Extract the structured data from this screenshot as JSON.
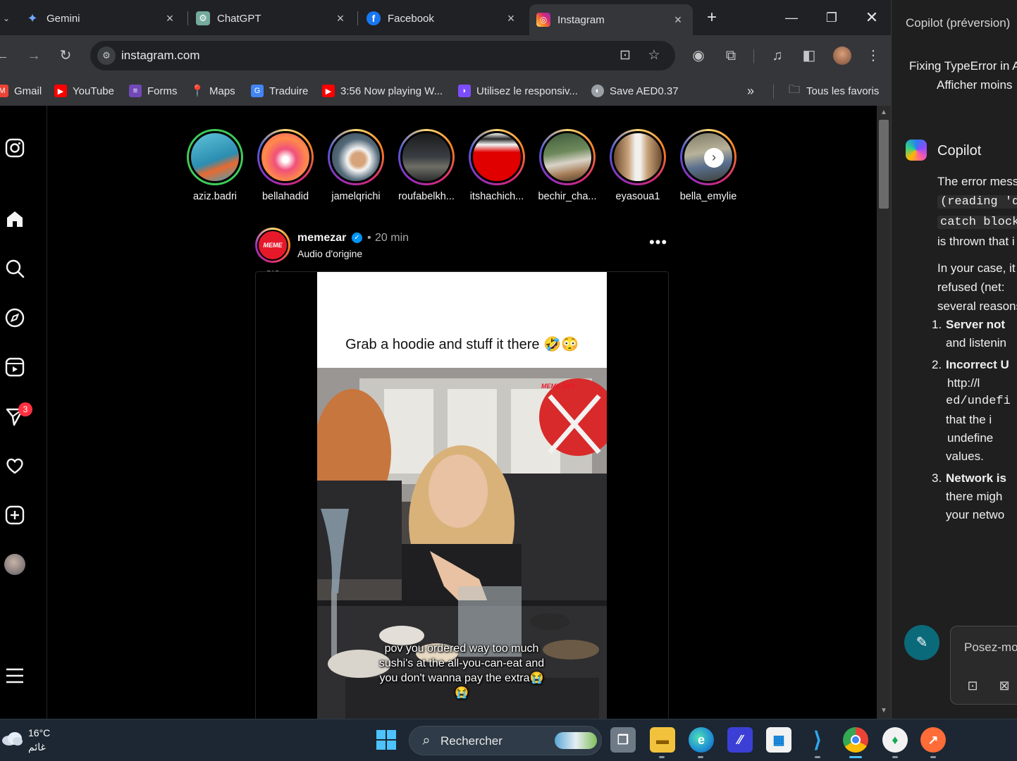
{
  "browser": {
    "tabs": [
      {
        "label": "Gemini",
        "icon": "gemini-icon",
        "active": false
      },
      {
        "label": "ChatGPT",
        "icon": "chatgpt-icon",
        "active": false
      },
      {
        "label": "Facebook",
        "icon": "facebook-icon",
        "active": false
      },
      {
        "label": "Instagram",
        "icon": "instagram-icon",
        "active": true
      }
    ],
    "url": "instagram.com",
    "bookmarks": [
      {
        "label": "Gmail",
        "icon": "gmail-icon",
        "color": "#ea4335"
      },
      {
        "label": "YouTube",
        "icon": "youtube-icon",
        "color": "#ff0000"
      },
      {
        "label": "Forms",
        "icon": "forms-icon",
        "color": "#7248b9"
      },
      {
        "label": "Maps",
        "icon": "maps-icon",
        "color": "#34a853"
      },
      {
        "label": "Traduire",
        "icon": "translate-icon",
        "color": "#4285f4"
      },
      {
        "label": "3:56 Now playing W...",
        "icon": "youtube-icon",
        "color": "#ff0000"
      },
      {
        "label": "Utilisez le responsiv...",
        "icon": "bookmark-app-icon",
        "color": "#7c4dff"
      },
      {
        "label": "Save AED0.37",
        "icon": "globe-icon",
        "color": "#9aa0a6"
      }
    ],
    "all_bookmarks": "Tous les favoris"
  },
  "instagram": {
    "stories": [
      {
        "username": "aziz.badri",
        "seen": true
      },
      {
        "username": "bellahadid",
        "seen": false
      },
      {
        "username": "jamelqrichi",
        "seen": false
      },
      {
        "username": "roufabelkh...",
        "seen": false
      },
      {
        "username": "itshachich...",
        "seen": false
      },
      {
        "username": "bechir_cha...",
        "seen": false
      },
      {
        "username": "eyasoua1",
        "seen": false
      },
      {
        "username": "bella_emylie",
        "seen": false
      }
    ],
    "notification_count": "3",
    "post": {
      "username": "memezar",
      "verified": true,
      "time": "20 min",
      "audio": "Audio d'origine",
      "avatar_text": "MEME ZAR",
      "caption_top": "Grab a hoodie and stuff it there 🤣😳",
      "subtitle": "pov you ordered way too much sushi's at the all-you-can-eat and you don't wanna pay the extra😭😭",
      "watermark": "MEME ZAR"
    }
  },
  "copilot": {
    "title": "Copilot (préversion)",
    "conversation_title": "Fixing TypeError in A",
    "faded_text": "Afficher moins",
    "assistant_name": "Copilot",
    "paragraph1": [
      "The error mess",
      "(reading 'da",
      "catch block",
      "is thrown that i"
    ],
    "paragraph2": [
      "In your case, it",
      "refused (net:",
      "several reasons"
    ],
    "list": [
      {
        "num": "1.",
        "title": "Server not",
        "lines": [
          "and listenin"
        ]
      },
      {
        "num": "2.",
        "title": "Incorrect U",
        "lines": [
          "http://l",
          "ed/undefi",
          "that the i",
          "undefine",
          "values."
        ]
      },
      {
        "num": "3.",
        "title": "Network is",
        "lines": [
          "there migh",
          "your netwo"
        ]
      }
    ],
    "input_placeholder": "Posez-mo"
  },
  "taskbar": {
    "temperature": "16°C",
    "condition": "غائم",
    "search_label": "Rechercher"
  }
}
